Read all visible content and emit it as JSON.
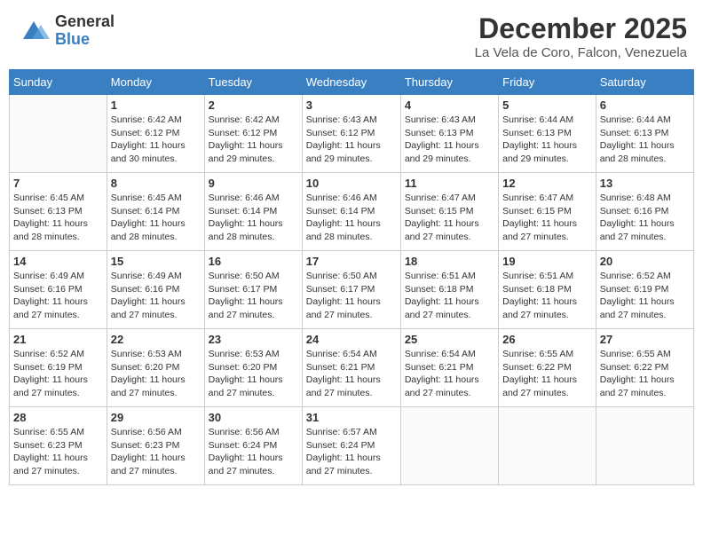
{
  "header": {
    "logo_general": "General",
    "logo_blue": "Blue",
    "month": "December 2025",
    "location": "La Vela de Coro, Falcon, Venezuela"
  },
  "days_of_week": [
    "Sunday",
    "Monday",
    "Tuesday",
    "Wednesday",
    "Thursday",
    "Friday",
    "Saturday"
  ],
  "weeks": [
    [
      {
        "day": "",
        "info": ""
      },
      {
        "day": "1",
        "info": "Sunrise: 6:42 AM\nSunset: 6:12 PM\nDaylight: 11 hours and 30 minutes."
      },
      {
        "day": "2",
        "info": "Sunrise: 6:42 AM\nSunset: 6:12 PM\nDaylight: 11 hours and 29 minutes."
      },
      {
        "day": "3",
        "info": "Sunrise: 6:43 AM\nSunset: 6:12 PM\nDaylight: 11 hours and 29 minutes."
      },
      {
        "day": "4",
        "info": "Sunrise: 6:43 AM\nSunset: 6:13 PM\nDaylight: 11 hours and 29 minutes."
      },
      {
        "day": "5",
        "info": "Sunrise: 6:44 AM\nSunset: 6:13 PM\nDaylight: 11 hours and 29 minutes."
      },
      {
        "day": "6",
        "info": "Sunrise: 6:44 AM\nSunset: 6:13 PM\nDaylight: 11 hours and 28 minutes."
      }
    ],
    [
      {
        "day": "7",
        "info": "Sunrise: 6:45 AM\nSunset: 6:13 PM\nDaylight: 11 hours and 28 minutes."
      },
      {
        "day": "8",
        "info": "Sunrise: 6:45 AM\nSunset: 6:14 PM\nDaylight: 11 hours and 28 minutes."
      },
      {
        "day": "9",
        "info": "Sunrise: 6:46 AM\nSunset: 6:14 PM\nDaylight: 11 hours and 28 minutes."
      },
      {
        "day": "10",
        "info": "Sunrise: 6:46 AM\nSunset: 6:14 PM\nDaylight: 11 hours and 28 minutes."
      },
      {
        "day": "11",
        "info": "Sunrise: 6:47 AM\nSunset: 6:15 PM\nDaylight: 11 hours and 27 minutes."
      },
      {
        "day": "12",
        "info": "Sunrise: 6:47 AM\nSunset: 6:15 PM\nDaylight: 11 hours and 27 minutes."
      },
      {
        "day": "13",
        "info": "Sunrise: 6:48 AM\nSunset: 6:16 PM\nDaylight: 11 hours and 27 minutes."
      }
    ],
    [
      {
        "day": "14",
        "info": "Sunrise: 6:49 AM\nSunset: 6:16 PM\nDaylight: 11 hours and 27 minutes."
      },
      {
        "day": "15",
        "info": "Sunrise: 6:49 AM\nSunset: 6:16 PM\nDaylight: 11 hours and 27 minutes."
      },
      {
        "day": "16",
        "info": "Sunrise: 6:50 AM\nSunset: 6:17 PM\nDaylight: 11 hours and 27 minutes."
      },
      {
        "day": "17",
        "info": "Sunrise: 6:50 AM\nSunset: 6:17 PM\nDaylight: 11 hours and 27 minutes."
      },
      {
        "day": "18",
        "info": "Sunrise: 6:51 AM\nSunset: 6:18 PM\nDaylight: 11 hours and 27 minutes."
      },
      {
        "day": "19",
        "info": "Sunrise: 6:51 AM\nSunset: 6:18 PM\nDaylight: 11 hours and 27 minutes."
      },
      {
        "day": "20",
        "info": "Sunrise: 6:52 AM\nSunset: 6:19 PM\nDaylight: 11 hours and 27 minutes."
      }
    ],
    [
      {
        "day": "21",
        "info": "Sunrise: 6:52 AM\nSunset: 6:19 PM\nDaylight: 11 hours and 27 minutes."
      },
      {
        "day": "22",
        "info": "Sunrise: 6:53 AM\nSunset: 6:20 PM\nDaylight: 11 hours and 27 minutes."
      },
      {
        "day": "23",
        "info": "Sunrise: 6:53 AM\nSunset: 6:20 PM\nDaylight: 11 hours and 27 minutes."
      },
      {
        "day": "24",
        "info": "Sunrise: 6:54 AM\nSunset: 6:21 PM\nDaylight: 11 hours and 27 minutes."
      },
      {
        "day": "25",
        "info": "Sunrise: 6:54 AM\nSunset: 6:21 PM\nDaylight: 11 hours and 27 minutes."
      },
      {
        "day": "26",
        "info": "Sunrise: 6:55 AM\nSunset: 6:22 PM\nDaylight: 11 hours and 27 minutes."
      },
      {
        "day": "27",
        "info": "Sunrise: 6:55 AM\nSunset: 6:22 PM\nDaylight: 11 hours and 27 minutes."
      }
    ],
    [
      {
        "day": "28",
        "info": "Sunrise: 6:55 AM\nSunset: 6:23 PM\nDaylight: 11 hours and 27 minutes."
      },
      {
        "day": "29",
        "info": "Sunrise: 6:56 AM\nSunset: 6:23 PM\nDaylight: 11 hours and 27 minutes."
      },
      {
        "day": "30",
        "info": "Sunrise: 6:56 AM\nSunset: 6:24 PM\nDaylight: 11 hours and 27 minutes."
      },
      {
        "day": "31",
        "info": "Sunrise: 6:57 AM\nSunset: 6:24 PM\nDaylight: 11 hours and 27 minutes."
      },
      {
        "day": "",
        "info": ""
      },
      {
        "day": "",
        "info": ""
      },
      {
        "day": "",
        "info": ""
      }
    ]
  ]
}
